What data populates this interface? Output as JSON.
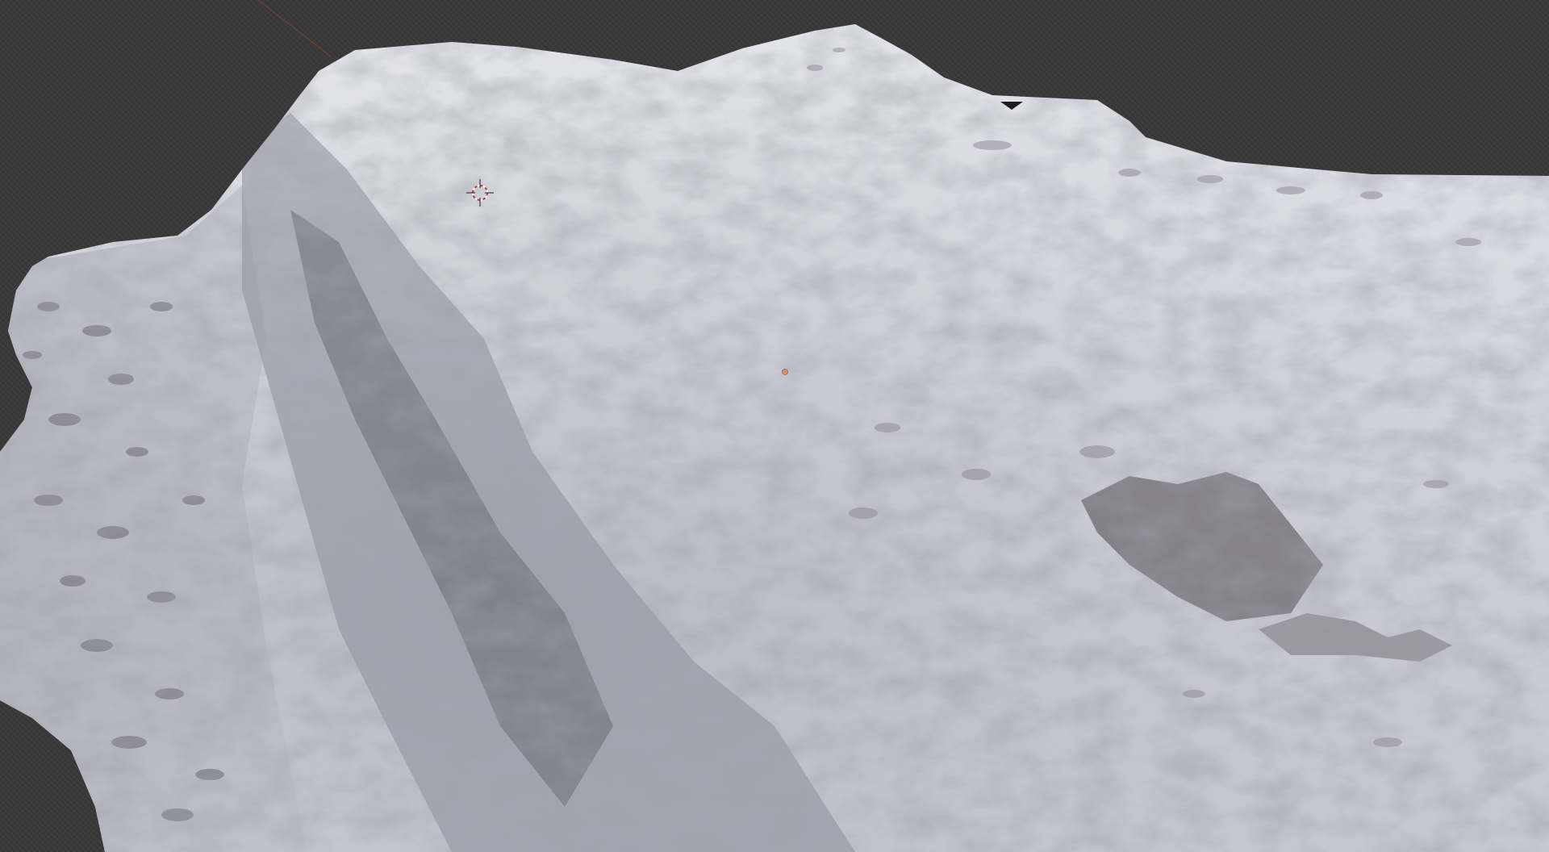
{
  "app": {
    "name": "3D viewport",
    "view": "perspective"
  },
  "viewport": {
    "background_color": "#393939",
    "object": "snow-terrain-scan",
    "overlays": {
      "cursor": "3d-cursor-icon",
      "origin": "object-origin-dot",
      "axis_line_color": "#b0413e",
      "origin_color": "#e0904a"
    }
  },
  "colors": {
    "snow_light": "#e8e8ee",
    "snow_shadow": "#a9a9b6",
    "rock_dark": "#4b4a4f"
  }
}
